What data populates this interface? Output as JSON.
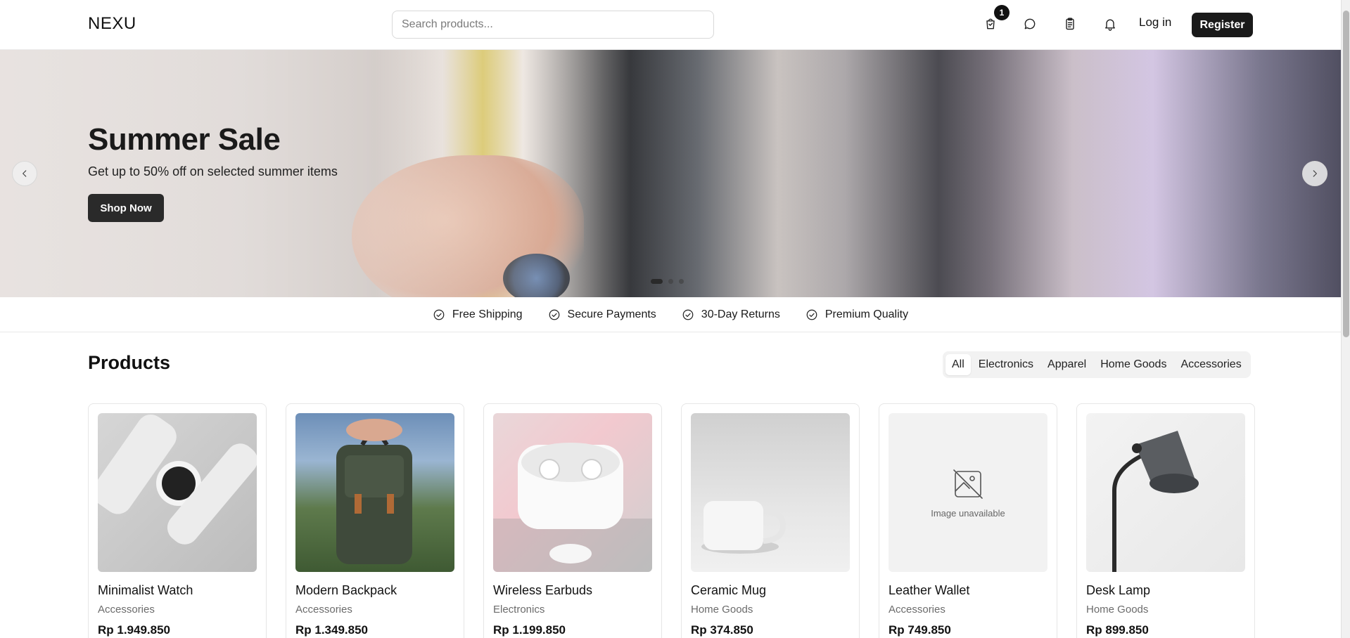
{
  "header": {
    "logo": "NEXU",
    "search_placeholder": "Search products...",
    "cart_badge": "1",
    "login_label": "Log in",
    "register_label": "Register",
    "icons": [
      "cart-icon",
      "chat-icon",
      "clipboard-icon",
      "bell-icon"
    ]
  },
  "hero": {
    "title": "Summer Sale",
    "subtitle": "Get up to 50% off on selected summer items",
    "cta_label": "Shop Now",
    "slides": 3,
    "active_slide": 1
  },
  "features": [
    {
      "label": "Free Shipping",
      "icon": "check-circle-icon"
    },
    {
      "label": "Secure Payments",
      "icon": "check-circle-icon"
    },
    {
      "label": "30-Day Returns",
      "icon": "check-circle-icon"
    },
    {
      "label": "Premium Quality",
      "icon": "check-circle-icon"
    }
  ],
  "products": {
    "title": "Products",
    "filters": [
      {
        "label": "All",
        "active": true
      },
      {
        "label": "Electronics",
        "active": false
      },
      {
        "label": "Apparel",
        "active": false
      },
      {
        "label": "Home Goods",
        "active": false
      },
      {
        "label": "Accessories",
        "active": false
      }
    ],
    "items": [
      {
        "name": "Minimalist Watch",
        "category": "Accessories",
        "price": "Rp 1.949.850"
      },
      {
        "name": "Modern Backpack",
        "category": "Accessories",
        "price": "Rp 1.349.850"
      },
      {
        "name": "Wireless Earbuds",
        "category": "Electronics",
        "price": "Rp 1.199.850"
      },
      {
        "name": "Ceramic Mug",
        "category": "Home Goods",
        "price": "Rp 374.850"
      },
      {
        "name": "Leather Wallet",
        "category": "Accessories",
        "price": "Rp 749.850",
        "image_unavailable_text": "Image unavailable"
      },
      {
        "name": "Desk Lamp",
        "category": "Home Goods",
        "price": "Rp 899.850"
      }
    ]
  }
}
